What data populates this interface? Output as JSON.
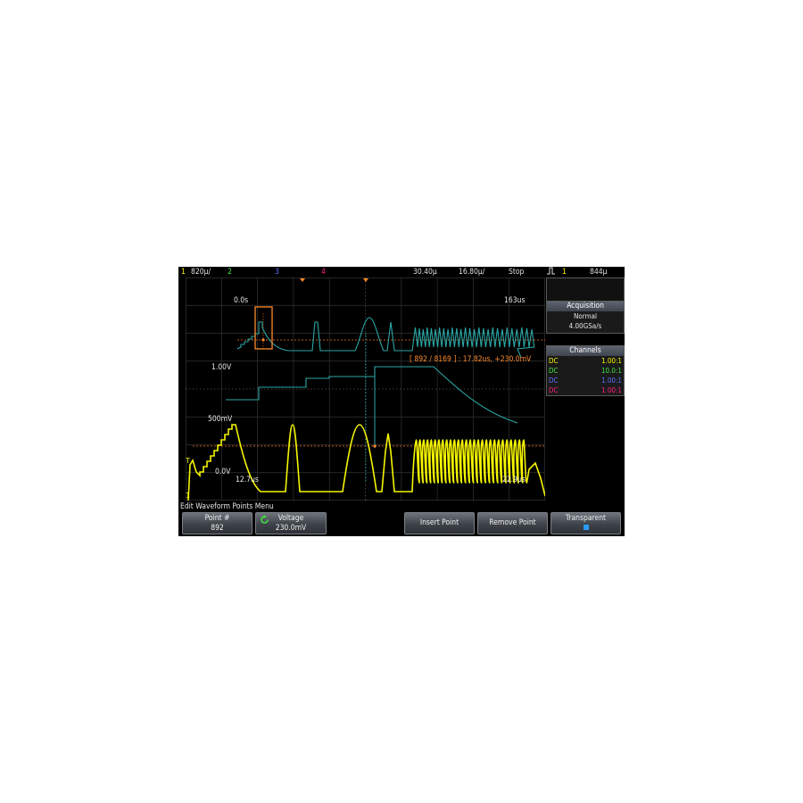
{
  "status_bar": {
    "ch1_num": "1",
    "ch1_scale": "820µ/",
    "ch2_num": "2",
    "ch3_num": "3",
    "ch4_num": "4",
    "delay": "30.40µ",
    "timebase": "16.80µ/",
    "run_state": "Stop",
    "trigger_icon": "rising-edge-icon",
    "trigger_source": "1",
    "trigger_level": "844µ"
  },
  "waveform_labels": {
    "upper_start": "0.0s",
    "upper_end": "163us",
    "point_readout": "[ 892 / 8169 ] : 17.82us, +230.0mV",
    "level_1v": "1.00V",
    "level_500mv": "500mV",
    "level_0v": "0.0V",
    "lower_start": "12.7us",
    "lower_end": "22.9us"
  },
  "acquisition": {
    "title": "Acquisition",
    "mode": "Normal",
    "rate": "4.00GSa/s"
  },
  "channels": {
    "title": "Channels",
    "rows": [
      {
        "coupling": "DC",
        "probe": "1.00:1",
        "color": "#f5f500"
      },
      {
        "coupling": "DC",
        "probe": "10.0:1",
        "color": "#40e040"
      },
      {
        "coupling": "DC",
        "probe": "1.00:1",
        "color": "#5a70ff"
      },
      {
        "coupling": "DC",
        "probe": "1.00:1",
        "color": "#ff2080"
      }
    ]
  },
  "menu": {
    "title": "Edit Waveform Points Menu",
    "point_label": "Point #",
    "point_value": "892",
    "voltage_label": "Voltage",
    "voltage_value": "230.0mV",
    "insert_label": "Insert Point",
    "remove_label": "Remove Point",
    "transparent_label": "Transparent"
  },
  "colors": {
    "ch1": "#f5f500",
    "ch2": "#40e040",
    "ch3": "#5a70ff",
    "ch4": "#ff2080",
    "arb": "#2aa6a6",
    "cursor": "#ff8a2a"
  }
}
